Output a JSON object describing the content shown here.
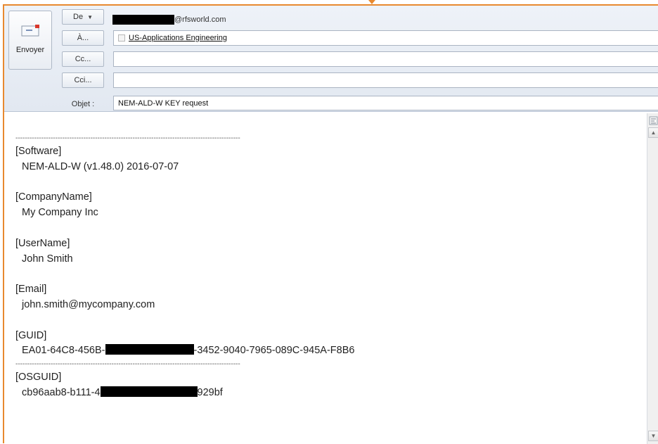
{
  "header": {
    "send": {
      "label": "Envoyer",
      "icon": "send-envelope-icon"
    },
    "from": {
      "button_label": "De",
      "dropdown_icon": "▼",
      "email_domain": "@rfsworld.com"
    },
    "to": {
      "button_label": "À...",
      "recipient": "US-Applications Engineering"
    },
    "cc": {
      "button_label": "Cc...",
      "value": ""
    },
    "bcc": {
      "button_label": "Cci...",
      "value": ""
    },
    "subject": {
      "label": "Objet :",
      "value": "NEM-ALD-W KEY request"
    }
  },
  "body": {
    "separator": "------------------------------------------------------------------------------------------------",
    "software_header": "[Software]",
    "software_value": "NEM-ALD-W (v1.48.0) 2016-07-07",
    "company_header": "[CompanyName]",
    "company_value": "My Company Inc",
    "user_header": "[UserName]",
    "user_value": "John Smith",
    "email_header": "[Email]",
    "email_value": "john.smith@mycompany.com",
    "guid_header": "[GUID]",
    "guid_prefix": "EA01-64C8-456B-",
    "guid_suffix": "-3452-9040-7965-089C-945A-F8B6",
    "osguid_header": "[OSGUID]",
    "osguid_prefix": "cb96aab8-b111-4",
    "osguid_suffix": "929bf"
  },
  "colors": {
    "window_border": "#e8892f",
    "header_bg": "#e2e8f1",
    "redaction": "#000000"
  }
}
